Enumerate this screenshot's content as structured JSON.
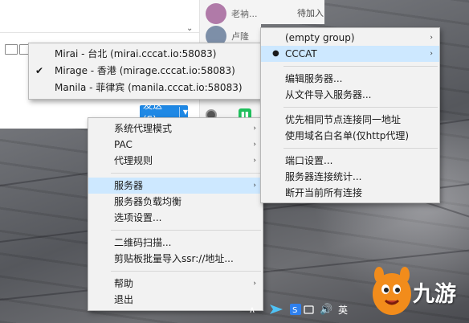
{
  "chat": {
    "items": [
      {
        "name": "老衲...",
        "status": "待加入",
        "avatar_color": "#b07aa8"
      },
      {
        "name": "卢隆",
        "avatar_color": "#7d8fa8"
      }
    ]
  },
  "app": {
    "send_label": "发送(S)",
    "send_arrow": "▼"
  },
  "server_list": {
    "items": [
      {
        "label": "Mirai - 台北 (mirai.cccat.io:58083)",
        "checked": false
      },
      {
        "label": "Mirage - 香港 (mirage.cccat.io:58083)",
        "checked": true
      },
      {
        "label": "Manila - 菲律宾 (manila.cccat.io:58083)",
        "checked": false
      }
    ],
    "check_glyph": "✔"
  },
  "tray_menu": {
    "items": [
      {
        "label": "系统代理模式",
        "submenu": true
      },
      {
        "label": "PAC",
        "submenu": true
      },
      {
        "label": "代理规则",
        "submenu": true
      },
      {
        "label": "服务器",
        "submenu": true,
        "highlight": true
      },
      {
        "label": "服务器负载均衡"
      },
      {
        "label": "选项设置..."
      },
      {
        "label": "二维码扫描..."
      },
      {
        "label": "剪贴板批量导入ssr://地址..."
      },
      {
        "label": "帮助",
        "submenu": true
      },
      {
        "label": "退出"
      }
    ],
    "arrow_glyph": "›"
  },
  "group_menu": {
    "items": [
      {
        "label": "(empty group)",
        "submenu": true
      },
      {
        "label": "CCCAT",
        "submenu": true,
        "highlight": true,
        "selected": true
      },
      {
        "label": "编辑服务器..."
      },
      {
        "label": "从文件导入服务器..."
      },
      {
        "label": "优先相同节点连接同一地址"
      },
      {
        "label": "使用域名白名单(仅http代理)"
      },
      {
        "label": "端口设置..."
      },
      {
        "label": "服务器连接统计..."
      },
      {
        "label": "断开当前所有连接"
      }
    ],
    "dot_glyph": "●"
  },
  "taskbar": {
    "up_arrow": "∧",
    "volume_icon": "🔊",
    "lang": "英"
  },
  "watermark": {
    "text": "九游"
  },
  "colors": {
    "menu_bg": "#f2f2f2",
    "highlight": "#cde8ff",
    "send_button": "#1e88e5"
  }
}
